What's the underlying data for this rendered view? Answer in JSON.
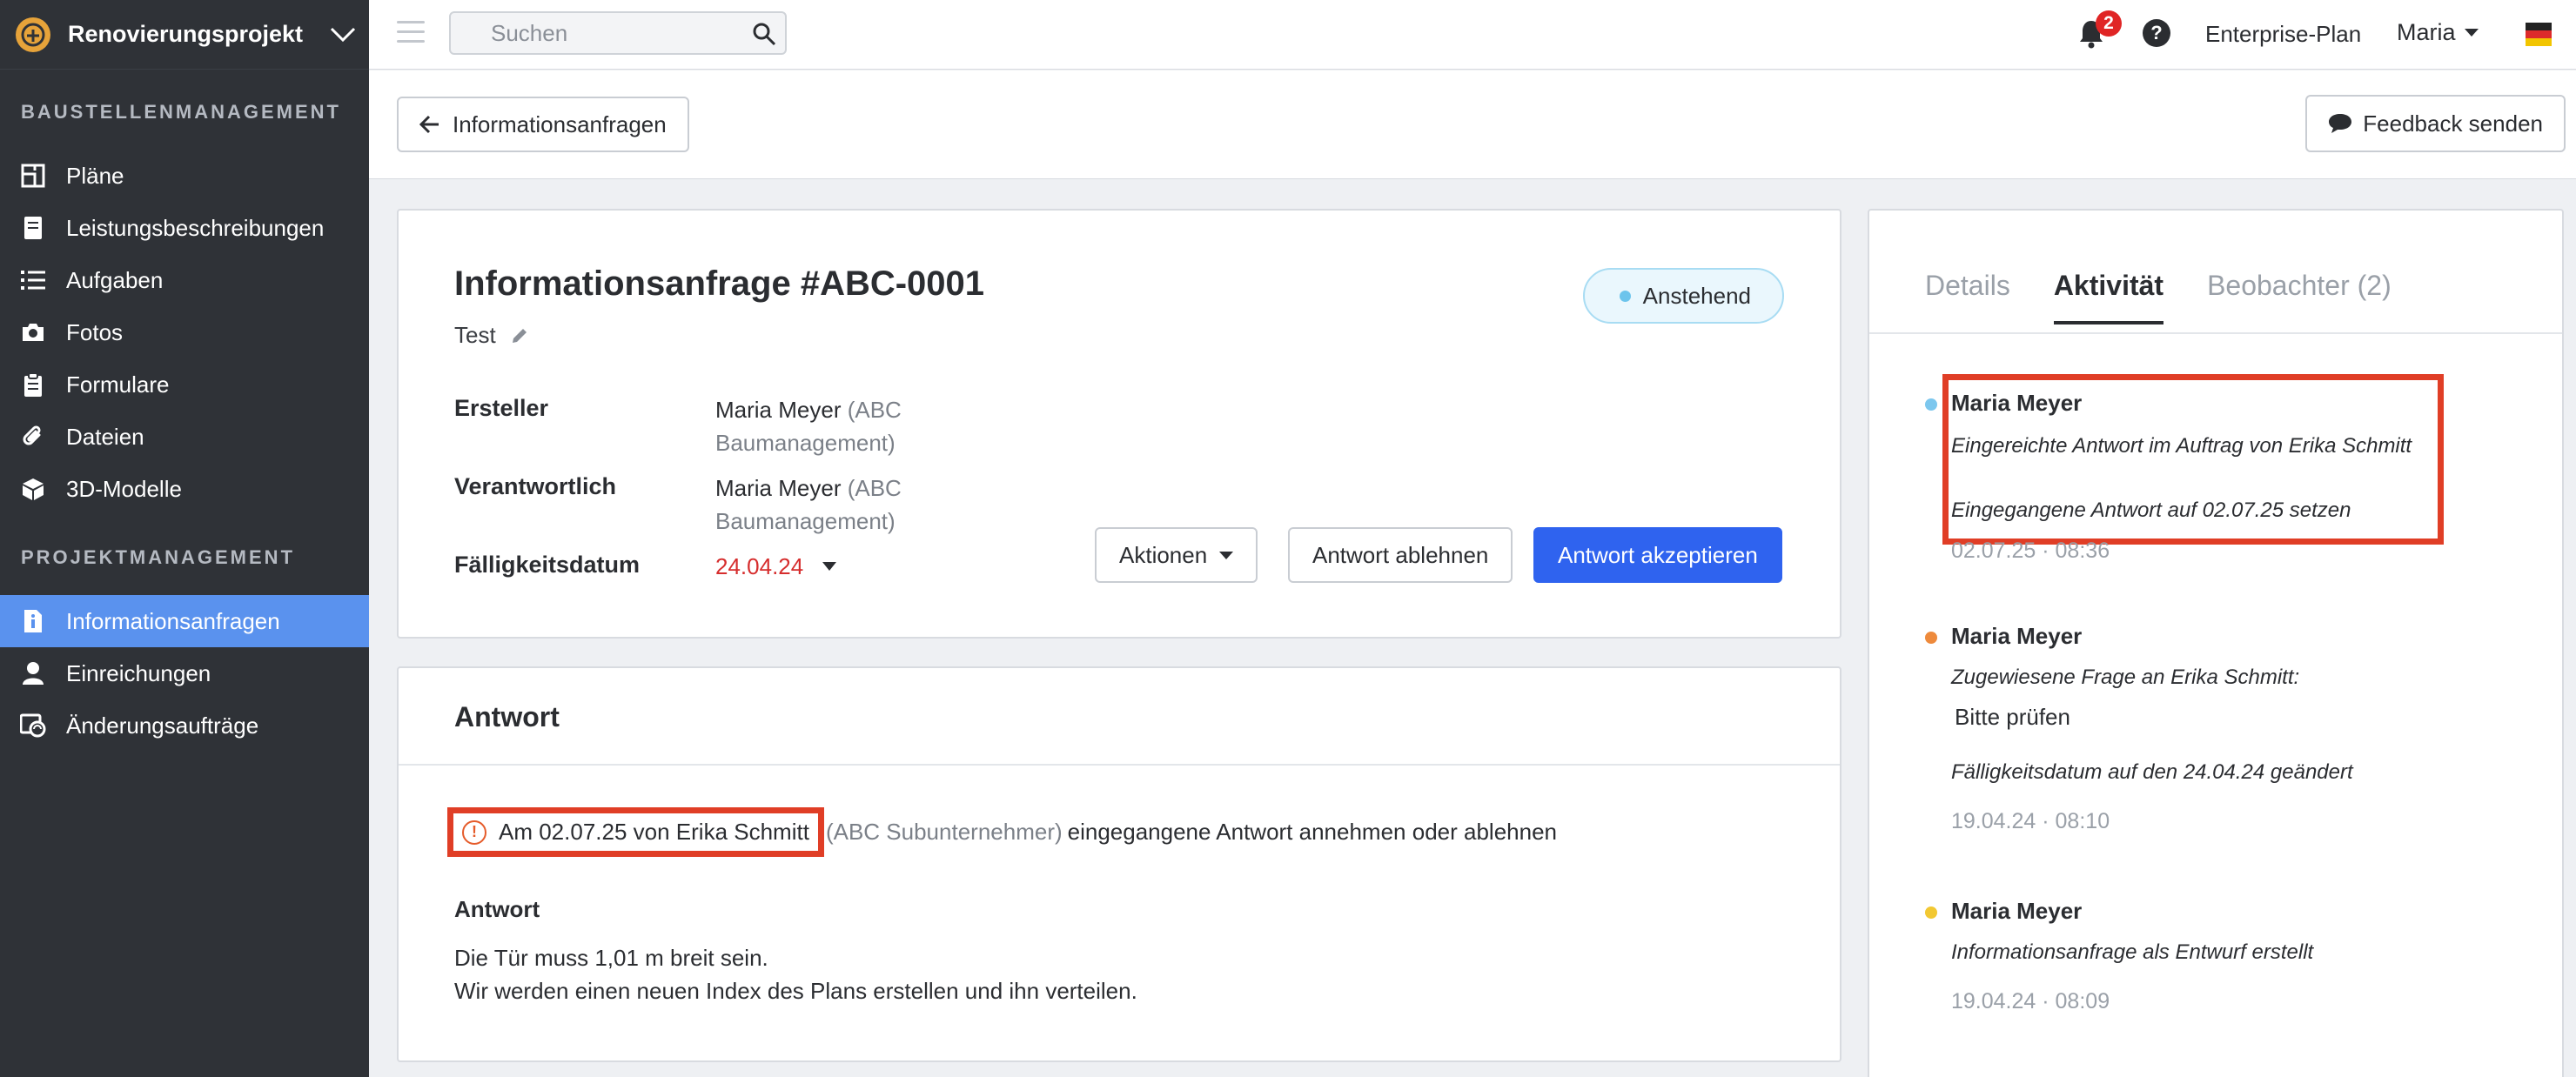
{
  "sidebar": {
    "project_name": "Renovierungsprojekt",
    "section1": "BAUSTELLENMANAGEMENT",
    "section2": "PROJEKTMANAGEMENT",
    "items1": [
      "Pläne",
      "Leistungsbeschreibungen",
      "Aufgaben",
      "Fotos",
      "Formulare",
      "Dateien",
      "3D-Modelle"
    ],
    "items2": [
      "Informationsanfragen",
      "Einreichungen",
      "Änderungsaufträge"
    ],
    "active_item": "Informationsanfragen"
  },
  "topbar": {
    "search_placeholder": "Suchen",
    "notification_count": "2",
    "help": "?",
    "plan": "Enterprise-Plan",
    "user": "Maria"
  },
  "subheader": {
    "back_label": "Informationsanfragen",
    "feedback_label": "Feedback senden"
  },
  "rfi": {
    "title": "Informationsanfrage #ABC-0001",
    "subtitle": "Test",
    "status": "Anstehend",
    "creator_label": "Ersteller",
    "creator_name": "Maria Meyer",
    "creator_org_line1": "(ABC",
    "creator_org_line2": "Baumanagement)",
    "responsible_label": "Verantwortlich",
    "responsible_name": "Maria Meyer",
    "responsible_org_line1": "(ABC",
    "responsible_org_line2": "Baumanagement)",
    "due_label": "Fälligkeitsdatum",
    "due_value": "24.04.24",
    "actions_label": "Aktionen",
    "reject_label": "Antwort ablehnen",
    "accept_label": "Antwort akzeptieren"
  },
  "answer": {
    "title": "Antwort",
    "notice_highlight": "Am 02.07.25 von Erika Schmitt",
    "notice_org": "(ABC Subunternehmer)",
    "notice_rest": "eingegangene Antwort annehmen oder ablehnen",
    "label": "Antwort",
    "line1": "Die Tür muss 1,01 m breit sein.",
    "line2": "Wir werden einen neuen Index des Plans erstellen und ihn verteilen."
  },
  "side": {
    "tabs": [
      "Details",
      "Aktivität",
      "Beobachter (2)"
    ],
    "active_tab": "Aktivität",
    "activities": [
      {
        "name": "Maria Meyer",
        "line1": "Eingereichte Antwort im Auftrag von Erika Schmitt",
        "line2": "Eingegangene Antwort auf 02.07.25 setzen",
        "time": "02.07.25 · 08:36",
        "dot_color": "#7cc7ee"
      },
      {
        "name": "Maria Meyer",
        "line1": "Zugewiesene Frage an Erika Schmitt:",
        "plain": "Bitte prüfen",
        "line2": "Fälligkeitsdatum auf den 24.04.24 geändert",
        "time": "19.04.24 · 08:10",
        "dot_color": "#ee8a3c"
      },
      {
        "name": "Maria Meyer",
        "line1": "Informationsanfrage als Entwurf erstellt",
        "time": "19.04.24 · 08:09",
        "dot_color": "#f2c832"
      }
    ]
  },
  "colors": {
    "sidebar_bg": "#2f3237",
    "active_nav": "#5a92ee",
    "primary_button": "#2f63ef",
    "due_date": "#d62d2d",
    "highlight_box": "#e03e26"
  }
}
